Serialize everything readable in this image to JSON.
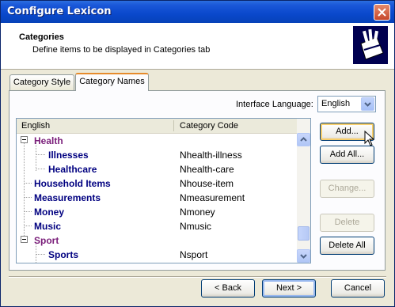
{
  "window": {
    "title": "Configure Lexicon"
  },
  "header": {
    "title": "Categories",
    "subtitle": "Define items to be displayed in Categories tab",
    "icon": "folder-chart-icon"
  },
  "tabs": [
    {
      "label": "Category Style",
      "active": false
    },
    {
      "label": "Category Names",
      "active": true
    }
  ],
  "language": {
    "label": "Interface Language:",
    "value": "English"
  },
  "list": {
    "columns": [
      "English",
      "Category Code"
    ],
    "rows": [
      {
        "name": "Health",
        "code": "",
        "expanded": true
      },
      {
        "name": "Illnesses",
        "code": "Nhealth-illness"
      },
      {
        "name": "Healthcare",
        "code": "Nhealth-care"
      },
      {
        "name": "Household Items",
        "code": "Nhouse-item"
      },
      {
        "name": "Measurements",
        "code": "Nmeasurement"
      },
      {
        "name": "Money",
        "code": "Nmoney"
      },
      {
        "name": "Music",
        "code": "Nmusic"
      },
      {
        "name": "Sport",
        "code": "",
        "expanded": true
      },
      {
        "name": "Sports",
        "code": "Nsport"
      }
    ]
  },
  "side_buttons": {
    "add": "Add...",
    "add_all": "Add All...",
    "change": "Change...",
    "delete": "Delete",
    "delete_all": "Delete All"
  },
  "footer": {
    "back": "< Back",
    "next": "Next >",
    "cancel": "Cancel"
  },
  "colors": {
    "title_bar": "#0a48cc",
    "group_text": "#7a1e7a",
    "item_text": "#000080",
    "face": "#ece9d8"
  }
}
